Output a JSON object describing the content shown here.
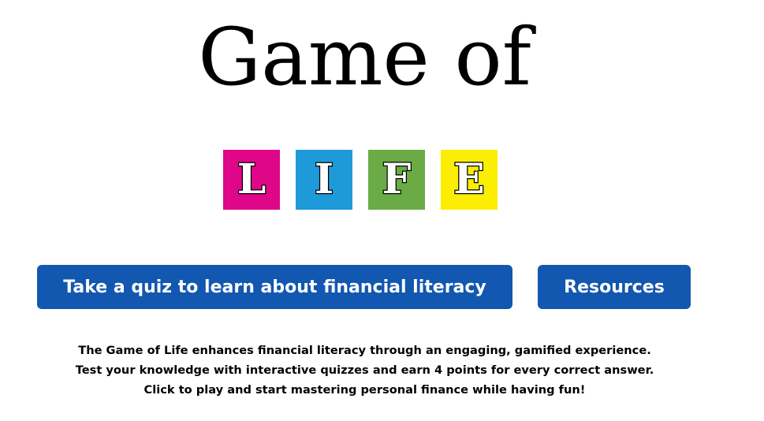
{
  "title": "Game of",
  "tiles": [
    {
      "letter": "L",
      "color": "#e0068a"
    },
    {
      "letter": "I",
      "color": "#1e9ad9"
    },
    {
      "letter": "F",
      "color": "#6aab45"
    },
    {
      "letter": "E",
      "color": "#fcee00"
    }
  ],
  "buttons": {
    "quiz_label": "Take a quiz to learn about financial literacy",
    "resources_label": "Resources",
    "color": "#1257b0"
  },
  "description": {
    "line1": "The Game of Life enhances financial literacy through an engaging, gamified experience.",
    "line2": "Test your knowledge with interactive quizzes and earn 4 points for every correct answer.",
    "line3": "Click to play and start mastering personal finance while having fun!"
  }
}
